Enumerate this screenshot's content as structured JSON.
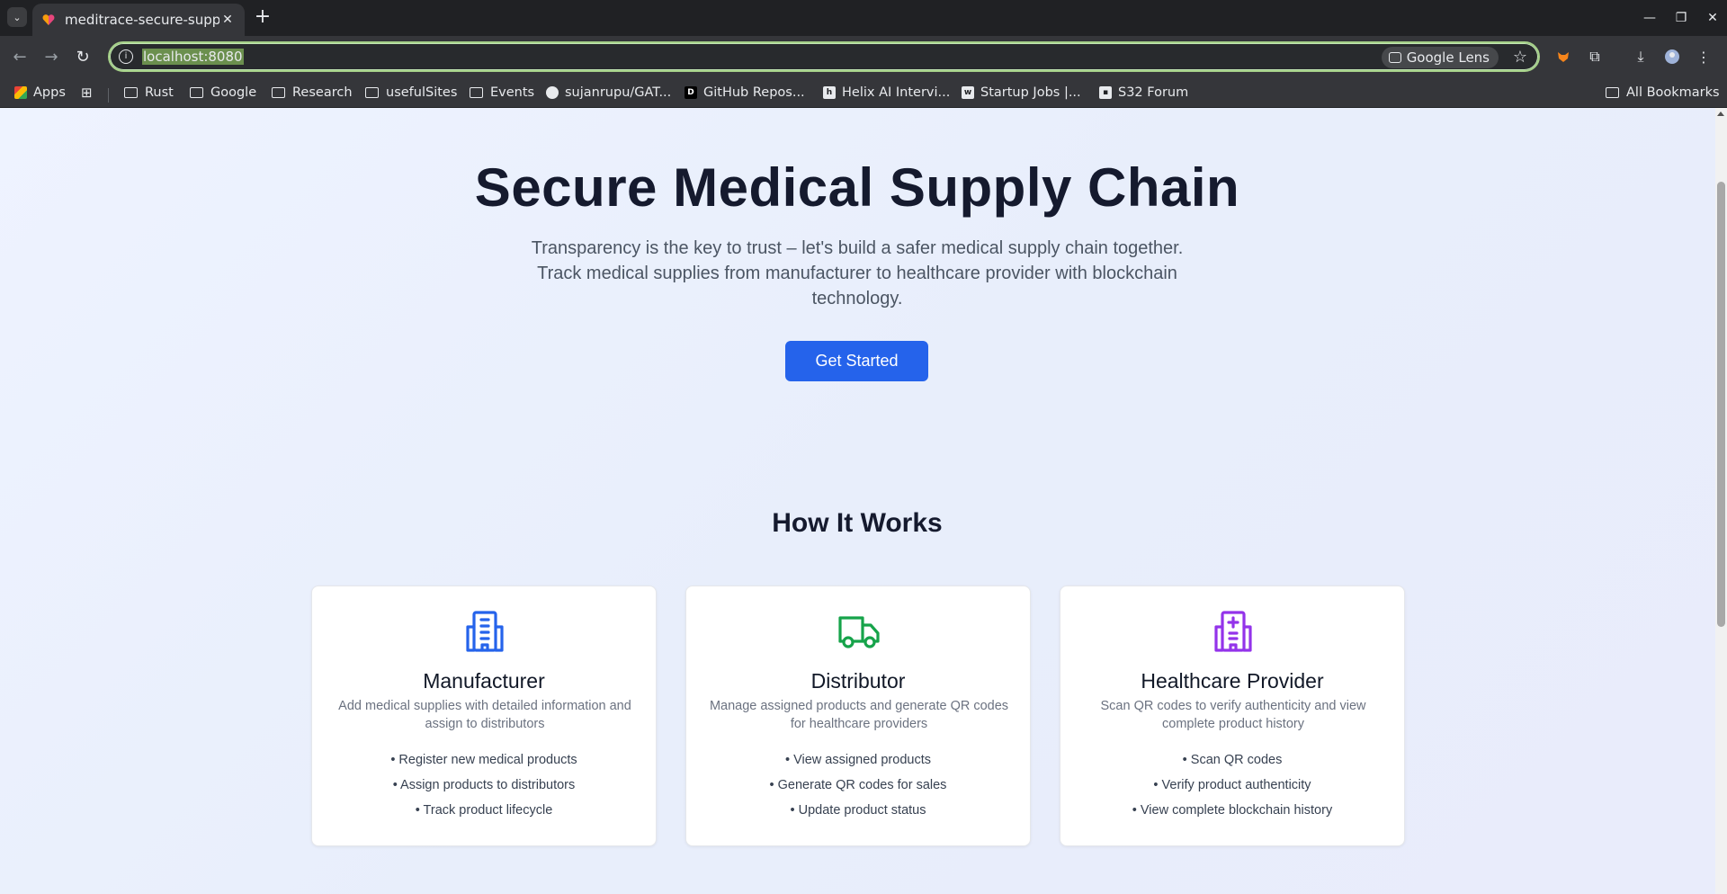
{
  "browser": {
    "tab_title": "meditrace-secure-supply",
    "url": "localhost:8080",
    "lens_label": "Google Lens",
    "bookmarks": [
      "Apps",
      "Rust",
      "Google",
      "Research",
      "usefulSites",
      "Events",
      "sujanrupu/GAT...",
      "GitHub Repos...",
      "Helix AI Intervi...",
      "Startup Jobs |...",
      "S32 Forum"
    ],
    "all_bookmarks": "All Bookmarks"
  },
  "hero": {
    "title": "Secure Medical Supply Chain",
    "subtitle": "Transparency is the key to trust – let's build a safer medical supply chain together. Track medical supplies from manufacturer to healthcare provider with blockchain technology.",
    "cta_label": "Get Started"
  },
  "how_it_works": {
    "title": "How It Works",
    "cards": [
      {
        "icon": "building-icon",
        "color": "#2563eb",
        "title": "Manufacturer",
        "description": "Add medical supplies with detailed information and assign to distributors",
        "items": [
          "• Register new medical products",
          "• Assign products to distributors",
          "• Track product lifecycle"
        ]
      },
      {
        "icon": "truck-icon",
        "color": "#16a34a",
        "title": "Distributor",
        "description": "Manage assigned products and generate QR codes for healthcare providers",
        "items": [
          "• View assigned products",
          "• Generate QR codes for sales",
          "• Update product status"
        ]
      },
      {
        "icon": "hospital-icon",
        "color": "#9333ea",
        "title": "Healthcare Provider",
        "description": "Scan QR codes to verify authenticity and view complete product history",
        "items": [
          "• Scan QR codes",
          "• Verify product authenticity",
          "• View complete blockchain history"
        ]
      }
    ]
  }
}
